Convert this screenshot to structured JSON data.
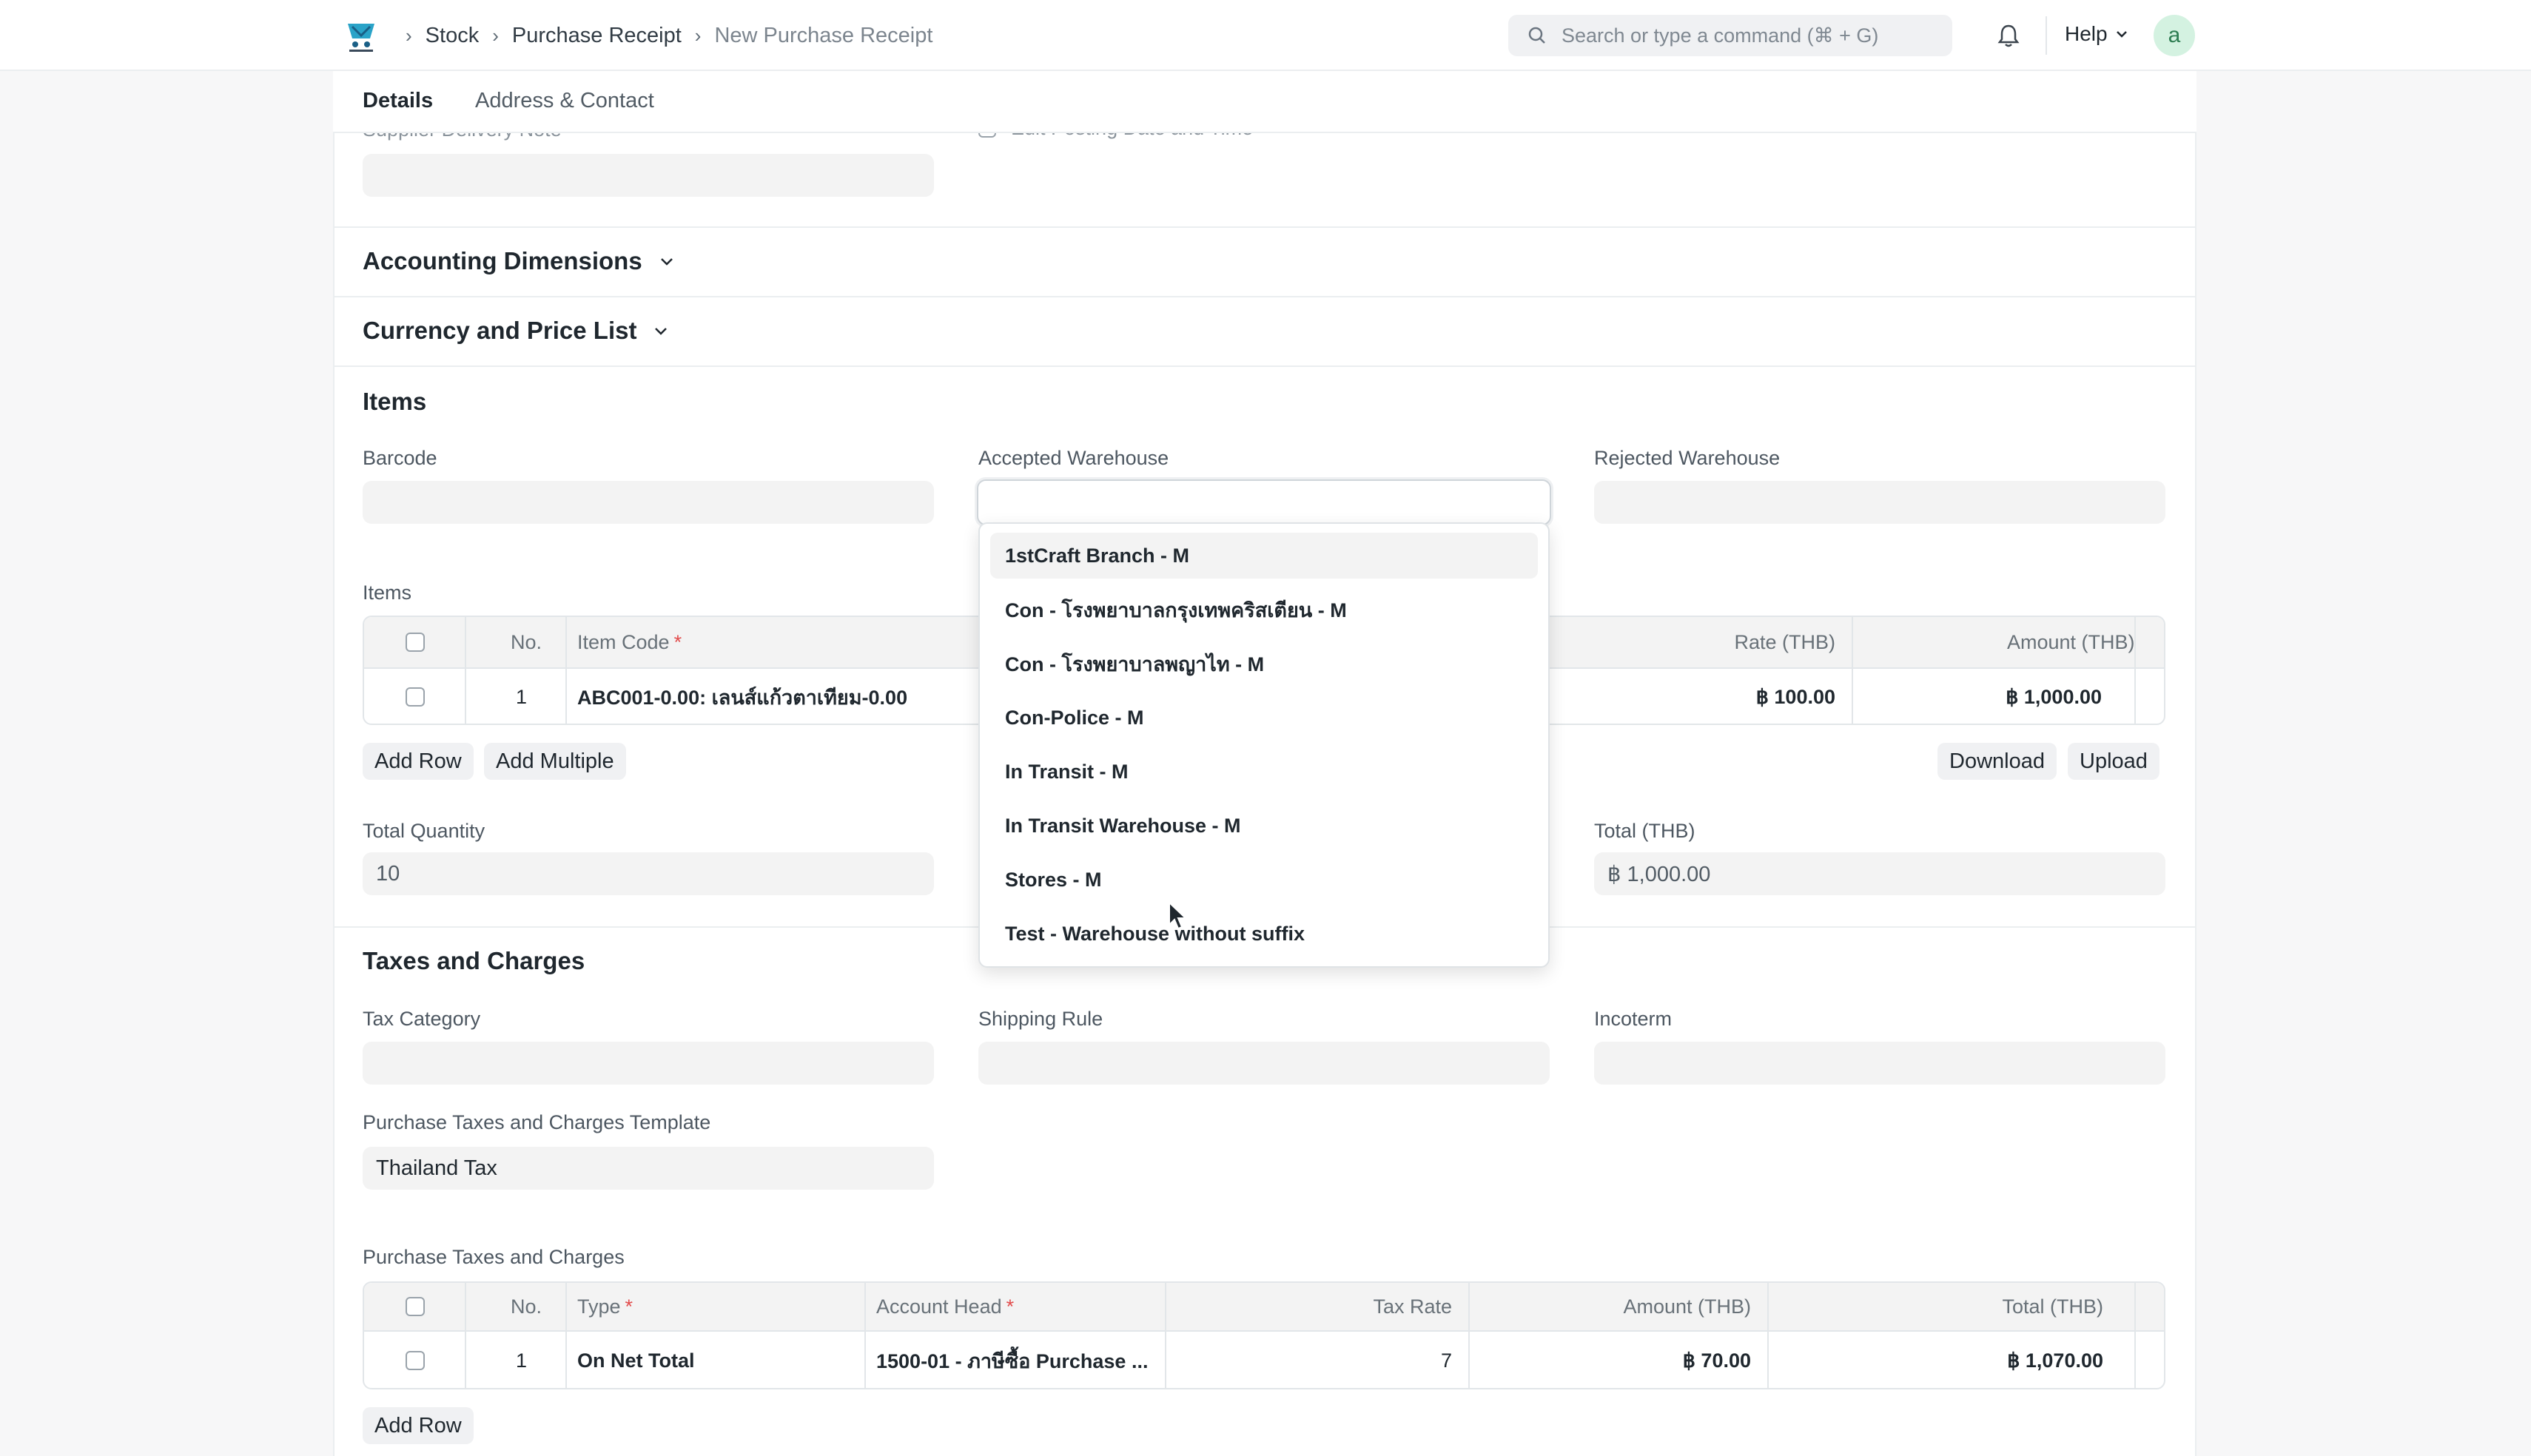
{
  "breadcrumbs": [
    "Stock",
    "Purchase Receipt",
    "New Purchase Receipt"
  ],
  "search": {
    "placeholder": "Search or type a command (⌘ + G)"
  },
  "help_label": "Help",
  "avatar_letter": "a",
  "tabs": [
    {
      "label": "Details"
    },
    {
      "label": "Address & Contact"
    }
  ],
  "partial": {
    "supplier_delivery_note": "Supplier Delivery Note",
    "edit_posting": "Edit Posting Date and Time"
  },
  "sections": {
    "accounting_dimensions": "Accounting Dimensions",
    "currency_price_list": "Currency and Price List",
    "items": "Items",
    "taxes": "Taxes and Charges"
  },
  "items_section": {
    "barcode_label": "Barcode",
    "accepted_warehouse_label": "Accepted Warehouse",
    "rejected_warehouse_label": "Rejected Warehouse",
    "table_label": "Items",
    "columns": {
      "no": "No.",
      "item_code": "Item Code",
      "rate": "Rate (THB)",
      "amount": "Amount (THB)"
    },
    "rows": [
      {
        "no": "1",
        "item_code": "ABC001-0.00: เลนส์แก้วตาเทียม-0.00",
        "rate": "฿ 100.00",
        "amount": "฿ 1,000.00"
      }
    ],
    "buttons": {
      "add_row": "Add Row",
      "add_multiple": "Add Multiple",
      "download": "Download",
      "upload": "Upload"
    },
    "total_quantity_label": "Total Quantity",
    "total_quantity": "10",
    "total_label": "Total (THB)",
    "total": "฿ 1,000.00"
  },
  "warehouse_options": [
    "1stCraft Branch - M",
    "Con - โรงพยาบาลกรุงเทพคริสเตียน - M",
    "Con - โรงพยาบาลพญาไท - M",
    "Con-Police - M",
    "In Transit - M",
    "In Transit Warehouse - M",
    "Stores - M",
    "Test - Warehouse without suffix"
  ],
  "taxes_section": {
    "tax_category_label": "Tax Category",
    "shipping_rule_label": "Shipping Rule",
    "incoterm_label": "Incoterm",
    "template_label": "Purchase Taxes and Charges Template",
    "template_value": "Thailand Tax",
    "table_label": "Purchase Taxes and Charges",
    "columns": {
      "no": "No.",
      "type": "Type",
      "account_head": "Account Head",
      "tax_rate": "Tax Rate",
      "amount": "Amount (THB)",
      "total": "Total (THB)"
    },
    "rows": [
      {
        "no": "1",
        "type": "On Net Total",
        "account_head": "1500-01 - ภาษีซื้อ Purchase ...",
        "tax_rate": "7",
        "amount": "฿ 70.00",
        "total": "฿ 1,070.00"
      }
    ],
    "add_row": "Add Row"
  }
}
